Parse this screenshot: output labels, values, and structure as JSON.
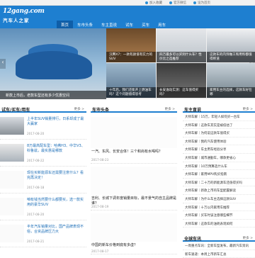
{
  "topbar": {
    "links": [
      "加入收藏",
      "官方微信",
      "设为首页"
    ]
  },
  "logo": {
    "text": "12gang.com",
    "subtitle": "汽车人之家",
    "badge": "88"
  },
  "nav": [
    "首页",
    "车市头条",
    "车主直说",
    "试车",
    "买车",
    "用车"
  ],
  "hero": {
    "caption": "新款上市后，老款车型还有多少优惠空间"
  },
  "tiles": [
    {
      "caption": "汉腾X7：一款有颜值有实力的SUV"
    },
    {
      "caption": "四万最多可以买到什么车？性价比之选推荐"
    },
    {
      "caption": "这款车的内饰做工和用料都值得称道"
    },
    {
      "caption": "十年后，我们还能开上燃油车吗？这个问题值得思考"
    },
    {
      "caption": "长安逸动实测：这车值得买吗？"
    },
    {
      "caption": "家用车主的选择，这款车好在哪"
    }
  ],
  "sections": {
    "left": {
      "title": "试车/买车/用车",
      "more": "更多 >",
      "items": [
        {
          "title": "上半年SUV销量排行，日系却成了最大赢家",
          "date": "2017-08-20"
        },
        {
          "title": "8万最高配车型：哈弗H3、中华V3、科鲁兹，最实惠是哪款",
          "date": "2017-08-22"
        },
        {
          "title": "现在买新能源车还需要注意什么？看完再决定！",
          "date": "2017-08-18"
        },
        {
          "title": "咱有钱当然要什么都要买，选一款实用的豪华SUV",
          "date": "2017-08-20"
        },
        {
          "title": "半年汽车销量对比，国产品牌表现不俗，合资品牌压力大",
          "date": "2017-08-21"
        }
      ]
    },
    "mid": {
      "title": "车市头条",
      "more": "更多 >",
      "items": [
        {
          "title": "一汽、东风、长安合体！三个和尚有水喝吗？",
          "date": "2017-08-23"
        },
        {
          "title": "吉利、长城下调年度销量目标，最不景气的自主品牌是谁？",
          "date": "2017-08-19"
        },
        {
          "title": "中国的新车价格到底有多虚？",
          "date": "2017-08-17"
        }
      ]
    },
    "right": {
      "title": "车主直说",
      "more": "更多 >",
      "items": [
        "大师车解｜15万，年轻人如何买一台车",
        "大师车解｜这款车其实是被低估了",
        "大师车解｜为何说这款车值得买",
        "大师车解｜我的汽车使用体验",
        "大师车解｜车主用车经验分享",
        "大师车解｜城市通勤车，哪款更省心",
        "大师车解｜10万预算选什么车",
        "大师车解｜家用MPV购买指南",
        "大师车解｜二十万的新能源车还值得买吗",
        "大师车解｜新款上市的车型配置解读",
        "大师车解｜为什么车主选择这款SUV",
        "大师车解｜十万以内家用车推荐",
        "大师车解｜买车时该注意哪些细节",
        "大师车解｜这款车的油耗表现如何",
        "大师车解｜轿车和SUV怎么选",
        "大师车解｜合资车和国产车的对比",
        "大师车解｜新手买车必看"
      ]
    },
    "fav": {
      "title": "全球车讯",
      "more": "更多 >",
      "items": [
        "一周重点车讯：全新车型发布，最新汽车资讯",
        "新车速递：本周上市新车汇总"
      ]
    }
  },
  "colors": {
    "brand": "#1e7fd0",
    "nav_active": "#0f5ea8"
  }
}
